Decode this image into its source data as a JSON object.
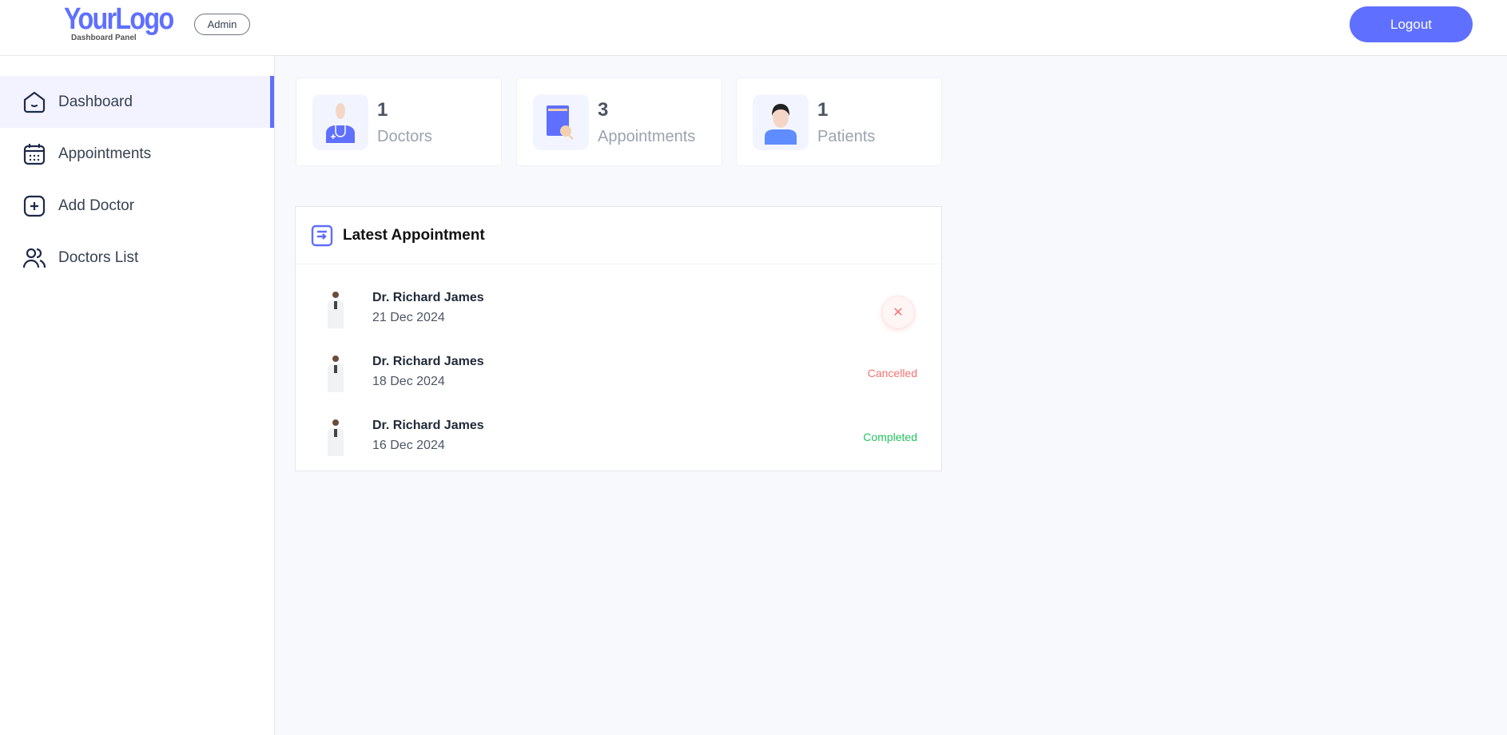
{
  "header": {
    "logo": "YourLogo",
    "logo_sub": "Dashboard Panel",
    "role_badge": "Admin",
    "logout_label": "Logout"
  },
  "sidebar": {
    "items": [
      {
        "label": "Dashboard",
        "icon": "home-icon",
        "active": true
      },
      {
        "label": "Appointments",
        "icon": "calendar-icon"
      },
      {
        "label": "Add Doctor",
        "icon": "add-square-icon"
      },
      {
        "label": "Doctors List",
        "icon": "people-icon"
      }
    ]
  },
  "stats": [
    {
      "value": "1",
      "label": "Doctors",
      "icon": "doctor-icon"
    },
    {
      "value": "3",
      "label": "Appointments",
      "icon": "appointment-book-icon"
    },
    {
      "value": "1",
      "label": "Patients",
      "icon": "patient-icon"
    }
  ],
  "latest": {
    "title": "Latest Appointment",
    "rows": [
      {
        "name": "Dr. Richard James",
        "date": "21 Dec 2024",
        "status": "",
        "action": "cancel"
      },
      {
        "name": "Dr. Richard James",
        "date": "18 Dec 2024",
        "status": "Cancelled"
      },
      {
        "name": "Dr. Richard James",
        "date": "16 Dec 2024",
        "status": "Completed"
      }
    ]
  },
  "colors": {
    "accent": "#5f6fff",
    "cancelled": "#f87171",
    "completed": "#22c55e"
  }
}
